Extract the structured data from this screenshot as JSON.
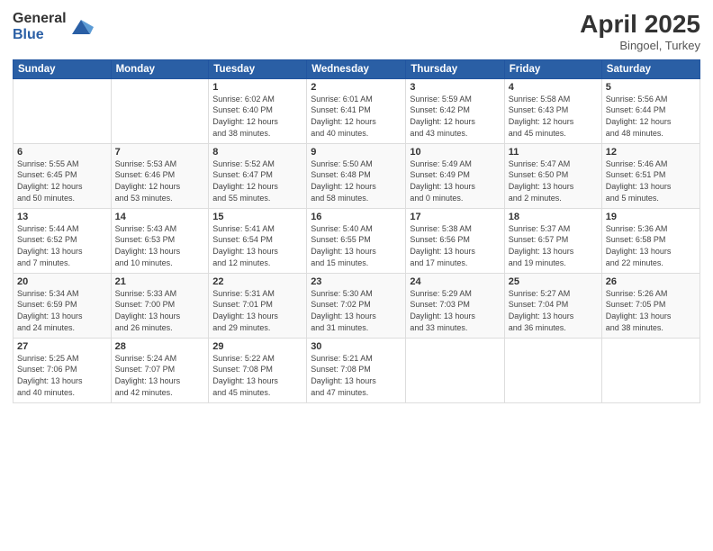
{
  "header": {
    "logo_general": "General",
    "logo_blue": "Blue",
    "month": "April 2025",
    "location": "Bingoel, Turkey"
  },
  "weekdays": [
    "Sunday",
    "Monday",
    "Tuesday",
    "Wednesday",
    "Thursday",
    "Friday",
    "Saturday"
  ],
  "weeks": [
    [
      {
        "day": "",
        "info": ""
      },
      {
        "day": "",
        "info": ""
      },
      {
        "day": "1",
        "info": "Sunrise: 6:02 AM\nSunset: 6:40 PM\nDaylight: 12 hours\nand 38 minutes."
      },
      {
        "day": "2",
        "info": "Sunrise: 6:01 AM\nSunset: 6:41 PM\nDaylight: 12 hours\nand 40 minutes."
      },
      {
        "day": "3",
        "info": "Sunrise: 5:59 AM\nSunset: 6:42 PM\nDaylight: 12 hours\nand 43 minutes."
      },
      {
        "day": "4",
        "info": "Sunrise: 5:58 AM\nSunset: 6:43 PM\nDaylight: 12 hours\nand 45 minutes."
      },
      {
        "day": "5",
        "info": "Sunrise: 5:56 AM\nSunset: 6:44 PM\nDaylight: 12 hours\nand 48 minutes."
      }
    ],
    [
      {
        "day": "6",
        "info": "Sunrise: 5:55 AM\nSunset: 6:45 PM\nDaylight: 12 hours\nand 50 minutes."
      },
      {
        "day": "7",
        "info": "Sunrise: 5:53 AM\nSunset: 6:46 PM\nDaylight: 12 hours\nand 53 minutes."
      },
      {
        "day": "8",
        "info": "Sunrise: 5:52 AM\nSunset: 6:47 PM\nDaylight: 12 hours\nand 55 minutes."
      },
      {
        "day": "9",
        "info": "Sunrise: 5:50 AM\nSunset: 6:48 PM\nDaylight: 12 hours\nand 58 minutes."
      },
      {
        "day": "10",
        "info": "Sunrise: 5:49 AM\nSunset: 6:49 PM\nDaylight: 13 hours\nand 0 minutes."
      },
      {
        "day": "11",
        "info": "Sunrise: 5:47 AM\nSunset: 6:50 PM\nDaylight: 13 hours\nand 2 minutes."
      },
      {
        "day": "12",
        "info": "Sunrise: 5:46 AM\nSunset: 6:51 PM\nDaylight: 13 hours\nand 5 minutes."
      }
    ],
    [
      {
        "day": "13",
        "info": "Sunrise: 5:44 AM\nSunset: 6:52 PM\nDaylight: 13 hours\nand 7 minutes."
      },
      {
        "day": "14",
        "info": "Sunrise: 5:43 AM\nSunset: 6:53 PM\nDaylight: 13 hours\nand 10 minutes."
      },
      {
        "day": "15",
        "info": "Sunrise: 5:41 AM\nSunset: 6:54 PM\nDaylight: 13 hours\nand 12 minutes."
      },
      {
        "day": "16",
        "info": "Sunrise: 5:40 AM\nSunset: 6:55 PM\nDaylight: 13 hours\nand 15 minutes."
      },
      {
        "day": "17",
        "info": "Sunrise: 5:38 AM\nSunset: 6:56 PM\nDaylight: 13 hours\nand 17 minutes."
      },
      {
        "day": "18",
        "info": "Sunrise: 5:37 AM\nSunset: 6:57 PM\nDaylight: 13 hours\nand 19 minutes."
      },
      {
        "day": "19",
        "info": "Sunrise: 5:36 AM\nSunset: 6:58 PM\nDaylight: 13 hours\nand 22 minutes."
      }
    ],
    [
      {
        "day": "20",
        "info": "Sunrise: 5:34 AM\nSunset: 6:59 PM\nDaylight: 13 hours\nand 24 minutes."
      },
      {
        "day": "21",
        "info": "Sunrise: 5:33 AM\nSunset: 7:00 PM\nDaylight: 13 hours\nand 26 minutes."
      },
      {
        "day": "22",
        "info": "Sunrise: 5:31 AM\nSunset: 7:01 PM\nDaylight: 13 hours\nand 29 minutes."
      },
      {
        "day": "23",
        "info": "Sunrise: 5:30 AM\nSunset: 7:02 PM\nDaylight: 13 hours\nand 31 minutes."
      },
      {
        "day": "24",
        "info": "Sunrise: 5:29 AM\nSunset: 7:03 PM\nDaylight: 13 hours\nand 33 minutes."
      },
      {
        "day": "25",
        "info": "Sunrise: 5:27 AM\nSunset: 7:04 PM\nDaylight: 13 hours\nand 36 minutes."
      },
      {
        "day": "26",
        "info": "Sunrise: 5:26 AM\nSunset: 7:05 PM\nDaylight: 13 hours\nand 38 minutes."
      }
    ],
    [
      {
        "day": "27",
        "info": "Sunrise: 5:25 AM\nSunset: 7:06 PM\nDaylight: 13 hours\nand 40 minutes."
      },
      {
        "day": "28",
        "info": "Sunrise: 5:24 AM\nSunset: 7:07 PM\nDaylight: 13 hours\nand 42 minutes."
      },
      {
        "day": "29",
        "info": "Sunrise: 5:22 AM\nSunset: 7:08 PM\nDaylight: 13 hours\nand 45 minutes."
      },
      {
        "day": "30",
        "info": "Sunrise: 5:21 AM\nSunset: 7:08 PM\nDaylight: 13 hours\nand 47 minutes."
      },
      {
        "day": "",
        "info": ""
      },
      {
        "day": "",
        "info": ""
      },
      {
        "day": "",
        "info": ""
      }
    ]
  ]
}
